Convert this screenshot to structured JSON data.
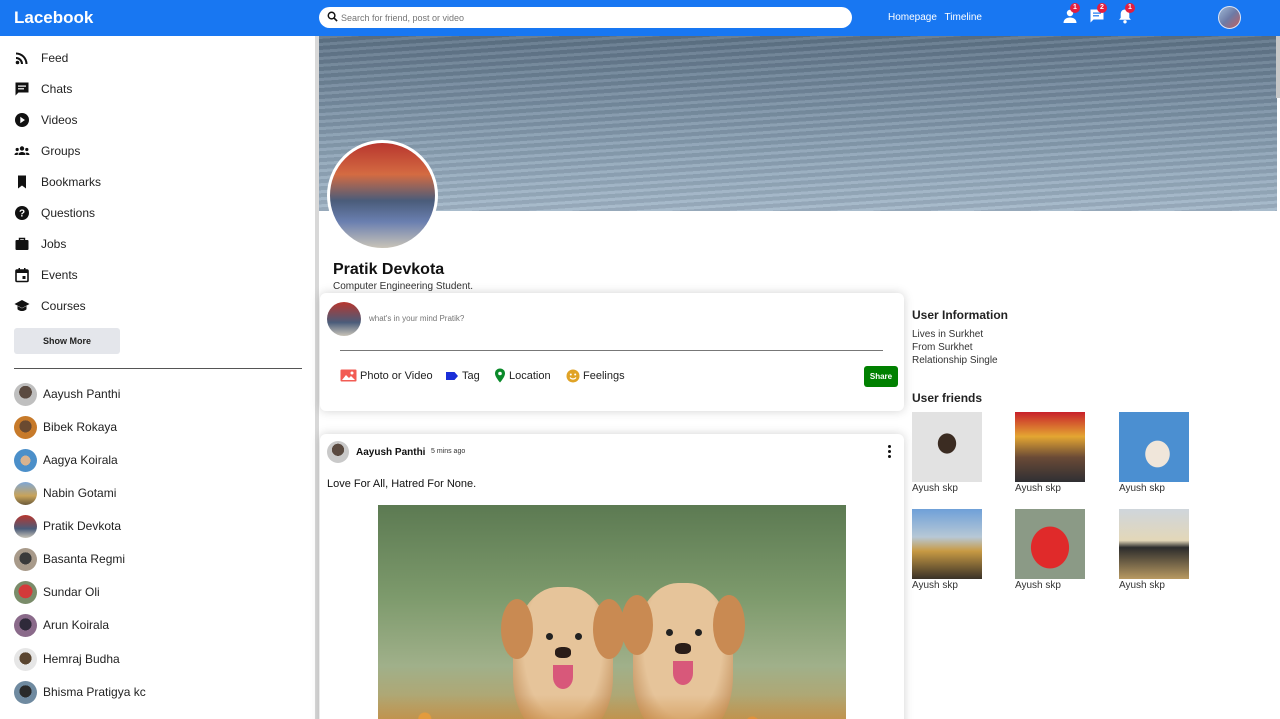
{
  "app": {
    "logo": "Lacebook"
  },
  "topbar": {
    "search_placeholder": "Search for friend, post or video",
    "links": [
      "Homepage",
      "Timeline"
    ],
    "icons": [
      {
        "name": "person-icon",
        "badge": "1"
      },
      {
        "name": "chat-icon",
        "badge": "2"
      },
      {
        "name": "notification-icon",
        "badge": "1"
      }
    ]
  },
  "sidebar": {
    "items": [
      {
        "name": "rss-feed-icon",
        "label": "Feed"
      },
      {
        "name": "chat-icon",
        "label": "Chats"
      },
      {
        "name": "play-circle-icon",
        "label": "Videos"
      },
      {
        "name": "group-icon",
        "label": "Groups"
      },
      {
        "name": "bookmark-icon",
        "label": "Bookmarks"
      },
      {
        "name": "help-circle-icon",
        "label": "Questions"
      },
      {
        "name": "work-icon",
        "label": "Jobs"
      },
      {
        "name": "event-icon",
        "label": "Events"
      },
      {
        "name": "school-icon",
        "label": "Courses"
      }
    ],
    "show_more": "Show More",
    "friends": [
      "Aayush Panthi",
      "Bibek Rokaya",
      "Aagya Koirala",
      "Nabin Gotami",
      "Pratik Devkota",
      "Basanta Regmi",
      "Sundar Oli",
      "Arun Koirala",
      "Hemraj Budha",
      "Bhisma Pratigya kc"
    ]
  },
  "profile": {
    "name": "Pratik Devkota",
    "description": "Computer Engineering Student."
  },
  "share": {
    "placeholder": "what's in your mind Pratik?",
    "options": [
      "Photo or Video",
      "Tag",
      "Location",
      "Feelings"
    ],
    "button": "Share"
  },
  "post": {
    "author": "Aayush Panthi",
    "time": "5 mins ago",
    "text": "Love For All, Hatred For None."
  },
  "user_info": {
    "title": "User Information",
    "lines": [
      "Lives in Surkhet",
      "From Surkhet",
      "Relationship Single"
    ]
  },
  "user_friends": {
    "title": "User friends",
    "names": [
      "Ayush skp",
      "Ayush skp",
      "Ayush skp",
      "Ayush skp",
      "Ayush skp",
      "Ayush skp"
    ]
  },
  "colors": {
    "brand": "#1877f2",
    "share_button": "#008000",
    "badge": "#e41e3f"
  }
}
